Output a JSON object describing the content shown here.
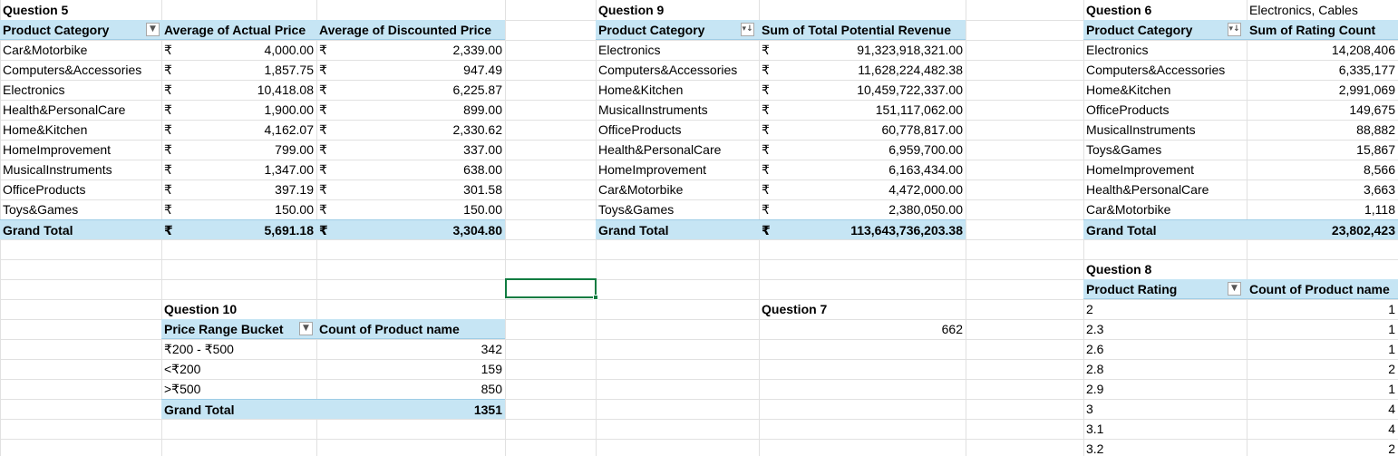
{
  "q5": {
    "title": "Question 5",
    "headers": [
      "Product Category",
      "Average of Actual Price",
      "Average of Discounted Price"
    ],
    "currency": "₹",
    "rows": [
      {
        "category": "Car&Motorbike",
        "actual": "4,000.00",
        "discounted": "2,339.00"
      },
      {
        "category": "Computers&Accessories",
        "actual": "1,857.75",
        "discounted": "947.49"
      },
      {
        "category": "Electronics",
        "actual": "10,418.08",
        "discounted": "6,225.87"
      },
      {
        "category": "Health&PersonalCare",
        "actual": "1,900.00",
        "discounted": "899.00"
      },
      {
        "category": "Home&Kitchen",
        "actual": "4,162.07",
        "discounted": "2,330.62"
      },
      {
        "category": "HomeImprovement",
        "actual": "799.00",
        "discounted": "337.00"
      },
      {
        "category": "MusicalInstruments",
        "actual": "1,347.00",
        "discounted": "638.00"
      },
      {
        "category": "OfficeProducts",
        "actual": "397.19",
        "discounted": "301.58"
      },
      {
        "category": "Toys&Games",
        "actual": "150.00",
        "discounted": "150.00"
      }
    ],
    "total": {
      "label": "Grand Total",
      "actual": "5,691.18",
      "discounted": "3,304.80"
    }
  },
  "q9": {
    "title": "Question 9",
    "headers": [
      "Product Category",
      "Sum of Total Potential Revenue"
    ],
    "currency": "₹",
    "rows": [
      {
        "category": "Electronics",
        "value": "91,323,918,321.00"
      },
      {
        "category": "Computers&Accessories",
        "value": "11,628,224,482.38"
      },
      {
        "category": "Home&Kitchen",
        "value": "10,459,722,337.00"
      },
      {
        "category": "MusicalInstruments",
        "value": "151,117,062.00"
      },
      {
        "category": "OfficeProducts",
        "value": "60,778,817.00"
      },
      {
        "category": "Health&PersonalCare",
        "value": "6,959,700.00"
      },
      {
        "category": "HomeImprovement",
        "value": "6,163,434.00"
      },
      {
        "category": "Car&Motorbike",
        "value": "4,472,000.00"
      },
      {
        "category": "Toys&Games",
        "value": "2,380,050.00"
      }
    ],
    "total": {
      "label": "Grand Total",
      "value": "113,643,736,203.38"
    }
  },
  "q6": {
    "title": "Question 6",
    "note": "Electronics, Cables",
    "headers": [
      "Product Category",
      "Sum of Rating Count"
    ],
    "rows": [
      {
        "category": "Electronics",
        "value": "14,208,406"
      },
      {
        "category": "Computers&Accessories",
        "value": "6,335,177"
      },
      {
        "category": "Home&Kitchen",
        "value": "2,991,069"
      },
      {
        "category": "OfficeProducts",
        "value": "149,675"
      },
      {
        "category": "MusicalInstruments",
        "value": "88,882"
      },
      {
        "category": "Toys&Games",
        "value": "15,867"
      },
      {
        "category": "HomeImprovement",
        "value": "8,566"
      },
      {
        "category": "Health&PersonalCare",
        "value": "3,663"
      },
      {
        "category": "Car&Motorbike",
        "value": "1,118"
      }
    ],
    "total": {
      "label": "Grand Total",
      "value": "23,802,423"
    }
  },
  "q8": {
    "title": "Question 8",
    "headers": [
      "Product Rating",
      "Count of Product name"
    ],
    "rows": [
      {
        "rating": "2",
        "value": "1"
      },
      {
        "rating": "2.3",
        "value": "1"
      },
      {
        "rating": "2.6",
        "value": "1"
      },
      {
        "rating": "2.8",
        "value": "2"
      },
      {
        "rating": "2.9",
        "value": "1"
      },
      {
        "rating": "3",
        "value": "4"
      },
      {
        "rating": "3.1",
        "value": "4"
      },
      {
        "rating": "3.2",
        "value": "2"
      }
    ]
  },
  "q10": {
    "title": "Question 10",
    "headers": [
      "Price Range Bucket",
      "Count of Product name"
    ],
    "rows": [
      {
        "bucket": "₹200 - ₹500",
        "value": "342"
      },
      {
        "bucket": "<₹200",
        "value": "159"
      },
      {
        "bucket": ">₹500",
        "value": "850"
      }
    ],
    "total": {
      "label": "Grand Total",
      "value": "1351"
    }
  },
  "q7": {
    "title": "Question 7",
    "value": "662"
  },
  "icons": {
    "filter": "filter-dropdown-icon",
    "sort_filter": "sort-descending-filter-icon"
  },
  "colors": {
    "pivot_header": "#c6e5f4",
    "gridline": "#e1e1e1",
    "selection": "#107c41"
  }
}
